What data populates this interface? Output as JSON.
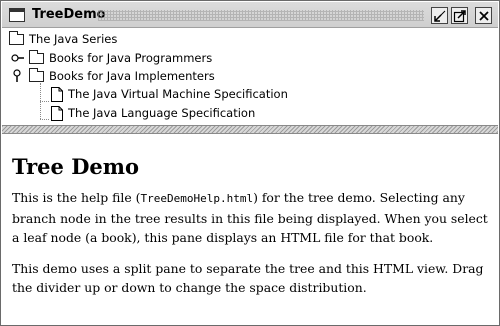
{
  "window": {
    "title": "TreeDemo"
  },
  "tree": {
    "root": {
      "label": "The Java Series",
      "icon": "folder-open-icon"
    },
    "nodes": [
      {
        "label": "Books for Java Programmers",
        "icon": "folder-icon",
        "expanded": false
      },
      {
        "label": "Books for Java Implementers",
        "icon": "folder-icon",
        "expanded": true,
        "children": [
          {
            "label": "The Java Virtual Machine Specification",
            "icon": "document-icon"
          },
          {
            "label": "The Java Language Specification",
            "icon": "document-icon"
          }
        ]
      }
    ]
  },
  "help": {
    "heading": "Tree Demo",
    "p1_before": "This is the help file (",
    "p1_code": "TreeDemoHelp.html",
    "p1_after": ") for the tree demo. Selecting any branch node in the tree results in this file being displayed. When you select a leaf node (a book), this pane displays an HTML file for that book.",
    "p2": "This demo uses a split pane to separate the tree and this HTML view. Drag the divider up or down to change the space distribution."
  }
}
